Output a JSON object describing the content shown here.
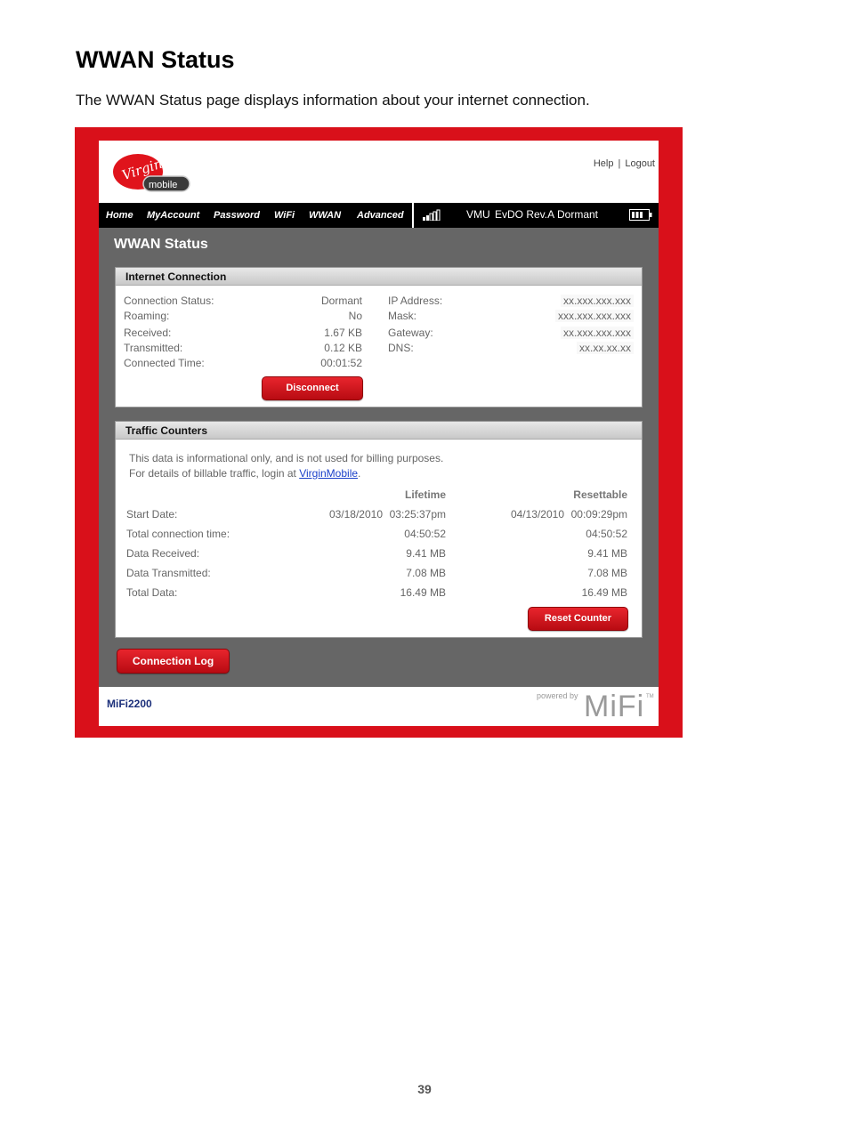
{
  "document": {
    "heading": "WWAN Status",
    "intro": "The WWAN Status page displays information about your internet connection.",
    "page_number": "39"
  },
  "header": {
    "logo_top": "Virgin",
    "logo_bottom": "mobile",
    "help": "Help",
    "separator": "|",
    "logout": "Logout"
  },
  "nav": {
    "items": [
      "Home",
      "MyAccount",
      "Password",
      "WiFi",
      "WWAN",
      "Advanced"
    ]
  },
  "status_bar": {
    "carrier": "VMU",
    "technology": "EvDO Rev.A",
    "state": "Dormant",
    "signal_bars": 2
  },
  "page_title": "WWAN Status",
  "internet_connection": {
    "title": "Internet Connection",
    "left": [
      {
        "label": "Connection Status:",
        "value": "Dormant"
      },
      {
        "label": "Roaming:",
        "value": "No"
      },
      {
        "label": "Received:",
        "value": "1.67 KB"
      },
      {
        "label": "Transmitted:",
        "value": "0.12 KB"
      },
      {
        "label": "Connected Time:",
        "value": "00:01:52"
      }
    ],
    "right": [
      {
        "label": "IP Address:",
        "value": "xx.xxx.xxx.xxx"
      },
      {
        "label": "Mask:",
        "value": "xxx.xxx.xxx.xxx"
      },
      {
        "label": "Gateway:",
        "value": "xx.xxx.xxx.xxx"
      },
      {
        "label": "DNS:",
        "value": "xx.xx.xx.xx"
      }
    ],
    "disconnect_label": "Disconnect"
  },
  "traffic_counters": {
    "title": "Traffic Counters",
    "note_line1": "This data is informational only, and is not used for billing purposes.",
    "note_line2_prefix": "For details of billable traffic, login at ",
    "note_link": "VirginMobile",
    "note_line2_suffix": ".",
    "col_lifetime": "Lifetime",
    "col_resettable": "Resettable",
    "start_date": {
      "label": "Start Date:",
      "lifetime_date": "03/18/2010",
      "lifetime_time": "03:25:37pm",
      "resettable_date": "04/13/2010",
      "resettable_time": "00:09:29pm"
    },
    "rows": [
      {
        "label": "Total connection time:",
        "lifetime": "04:50:52",
        "resettable": "04:50:52"
      },
      {
        "label": "Data Received:",
        "lifetime": "9.41 MB",
        "resettable": "9.41 MB"
      },
      {
        "label": "Data Transmitted:",
        "lifetime": "7.08 MB",
        "resettable": "7.08 MB"
      },
      {
        "label": "Total Data:",
        "lifetime": "16.49 MB",
        "resettable": "16.49 MB"
      }
    ],
    "reset_label": "Reset Counter"
  },
  "connection_log_label": "Connection Log",
  "footer": {
    "model": "MiFi2200",
    "powered_by": "powered by",
    "brand": "MiFi",
    "trademark": "TM"
  },
  "colors": {
    "frame_red": "#d9101a",
    "button_red": "#cc1119",
    "content_gray": "#666666",
    "model_blue": "#1b2f7a"
  }
}
